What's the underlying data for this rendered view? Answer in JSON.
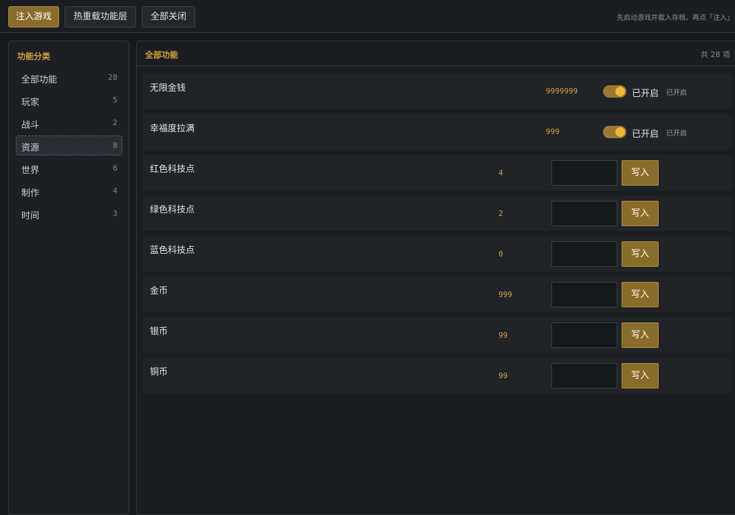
{
  "toolbar": {
    "inject_label": "注入游戏",
    "reload_label": "热重载功能层",
    "close_all_label": "全部关闭",
    "hint": "先启动游戏并载入存档，再点「注入」"
  },
  "sidebar": {
    "title": "功能分类",
    "items": [
      {
        "label": "全部功能",
        "count": "28"
      },
      {
        "label": "玩家",
        "count": "5"
      },
      {
        "label": "战斗",
        "count": "2"
      },
      {
        "label": "资源",
        "count": "8",
        "active": true
      },
      {
        "label": "世界",
        "count": "6"
      },
      {
        "label": "制作",
        "count": "4"
      },
      {
        "label": "时间",
        "count": "3"
      }
    ]
  },
  "main": {
    "title": "全部功能",
    "count_text": "共 28 项",
    "toggle_rows": [
      {
        "name": "无限金钱",
        "value": "9999999",
        "toggle_label": "已开启",
        "status": "已开启",
        "enabled": true
      },
      {
        "name": "幸福度拉满",
        "value": "999",
        "toggle_label": "已开启",
        "status": "已开启",
        "enabled": true
      }
    ],
    "input_rows": [
      {
        "name": "红色科技点",
        "value": "4",
        "button": "写入"
      },
      {
        "name": "绿色科技点",
        "value": "2",
        "button": "写入"
      },
      {
        "name": "蓝色科技点",
        "value": "0",
        "button": "写入"
      },
      {
        "name": "金币",
        "value": "999",
        "button": "写入"
      },
      {
        "name": "银币",
        "value": "99",
        "button": "写入"
      },
      {
        "name": "铜币",
        "value": "99",
        "button": "写入"
      }
    ]
  },
  "colors": {
    "accent": "#d6a240",
    "button_bg": "#8a6c2a",
    "background": "#15181c"
  }
}
